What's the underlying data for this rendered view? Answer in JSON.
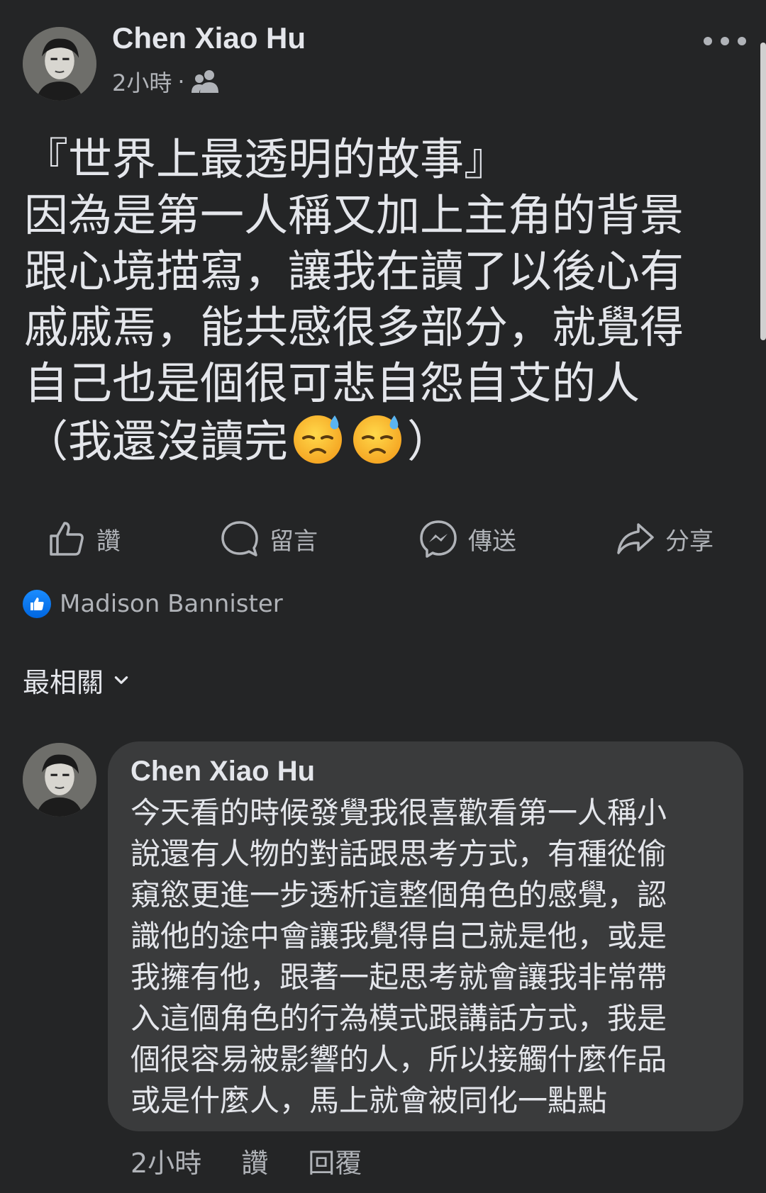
{
  "post": {
    "author": "Chen Xiao Hu",
    "time": "2小時",
    "separator": "·",
    "audience_icon": "friends-icon",
    "body_lines": [
      "『世界上最透明的故事』",
      "因為是第一人稱又加上主角的背景",
      "跟心境描寫，讓我在讀了以後心有",
      "戚戚焉，能共感很多部分，就覺得",
      "自己也是個很可悲自怨自艾的人",
      "（我還沒讀完"
    ],
    "body_end": "）",
    "emoji": "downcast-face-with-sweat"
  },
  "actions": {
    "like": "讚",
    "comment": "留言",
    "send": "傳送",
    "share": "分享"
  },
  "reactions": {
    "names": "Madison Bannister"
  },
  "comments_sort": {
    "label": "最相關"
  },
  "comment": {
    "author": "Chen Xiao Hu",
    "text_lines": [
      "今天看的時候發覺我很喜歡看第一人稱小",
      "說還有人物的對話跟思考方式，有種從偷",
      "窺慾更進一步透析這整個角色的感覺，認",
      "識他的途中會讓我覺得自己就是他，或是",
      "我擁有他，跟著一起思考就會讓我非常帶",
      "入這個角色的行為模式跟講話方式，我是",
      "個很容易被影響的人，所以接觸什麼作品",
      "或是什麼人，馬上就會被同化一點點"
    ],
    "time": "2小時",
    "like": "讚",
    "reply": "回覆"
  },
  "colors": {
    "background": "#242526",
    "bubble": "#3a3b3c",
    "text_primary": "#e4e6eb",
    "text_secondary": "#b0b3b8",
    "like_blue": "#1877f2"
  }
}
